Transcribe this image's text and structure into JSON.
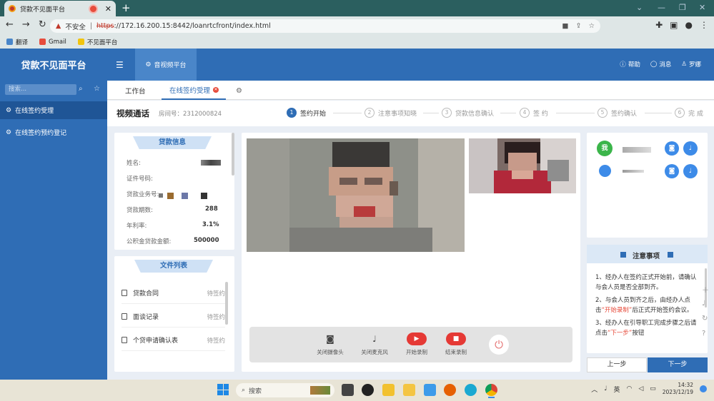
{
  "browser": {
    "tab_title": "贷款不见面平台",
    "tab_close": "✕",
    "new_tab": "+",
    "insecure_label": "不安全",
    "url_scheme": "https",
    "url_rest": "://172.16.200.15:8442/loanrtcfront/index.html",
    "bookmarks": [
      "翻译",
      "Gmail",
      "不见面平台"
    ]
  },
  "app": {
    "title": "贷款不见面平台",
    "module_tab": "音视频平台",
    "help": "帮助",
    "messages": "消息",
    "user": "罗娜"
  },
  "sidebar": {
    "search_placeholder": "搜索...",
    "items": [
      {
        "label": "在线签约受理"
      },
      {
        "label": "在线签约预约登记"
      }
    ]
  },
  "page_tabs": {
    "workbench": "工作台",
    "signing": "在线签约受理",
    "close_badge": "✕"
  },
  "header": {
    "title": "视频通话",
    "room_label": "房间号：",
    "room_number": "2312000824"
  },
  "steps": [
    {
      "num": "1",
      "label": "签约开始",
      "active": true
    },
    {
      "num": "2",
      "label": "注意事项知晓",
      "active": false
    },
    {
      "num": "3",
      "label": "贷款信息确认",
      "active": false
    },
    {
      "num": "4",
      "label": "签 约",
      "active": false
    },
    {
      "num": "5",
      "label": "签约确认",
      "active": false
    },
    {
      "num": "6",
      "label": "完 成",
      "active": false
    }
  ],
  "loan_info": {
    "title": "贷款信息",
    "fields": [
      {
        "label": "姓名:",
        "value": ""
      },
      {
        "label": "证件号码:",
        "value": ""
      },
      {
        "label": "贷款业务号:",
        "value": ""
      },
      {
        "label": "贷款期数:",
        "value": "288"
      },
      {
        "label": "年利率:",
        "value": "3.1%"
      },
      {
        "label": "公积金贷款金额:",
        "value": "500000"
      }
    ]
  },
  "file_list": {
    "title": "文件列表",
    "files": [
      {
        "name": "贷款合同",
        "status": "待签约"
      },
      {
        "name": "面谈记录",
        "status": "待签约"
      },
      {
        "name": "个贷申请确认表",
        "status": "待签约"
      }
    ]
  },
  "controls": [
    {
      "label": "关闭摄像头",
      "icon": "camera-icon"
    },
    {
      "label": "关闭麦克风",
      "icon": "microphone-icon"
    },
    {
      "label": "开始录制",
      "icon": "play-icon"
    },
    {
      "label": "结束录制",
      "icon": "stop-icon"
    },
    {
      "label": "",
      "icon": "power-icon"
    }
  ],
  "participants": [
    {
      "badge": "我",
      "name": ""
    },
    {
      "badge": "",
      "name": ""
    }
  ],
  "notes": {
    "title": "注意事项",
    "item1": "1、经办人在签约正式开始前，请确认与会人员是否全部到齐。",
    "item2_a": "2、与会人员到齐之后，由经办人点击",
    "item2_b": "“开始录制”",
    "item2_c": "后正式开始签约会议。",
    "item3_a": "3、经办人在引导职工完成步骤之后请点击",
    "item3_b": "“下一步”",
    "item3_c": "按钮"
  },
  "nav": {
    "prev": "上一步",
    "next": "下一步"
  },
  "taskbar": {
    "search": "搜索",
    "ime": "英",
    "time": "14:32",
    "date": "2023/12/19"
  },
  "colors": {
    "brand_blue": "#2f6db5",
    "record_red": "#e53935",
    "accent_red": "#e74c3c"
  }
}
